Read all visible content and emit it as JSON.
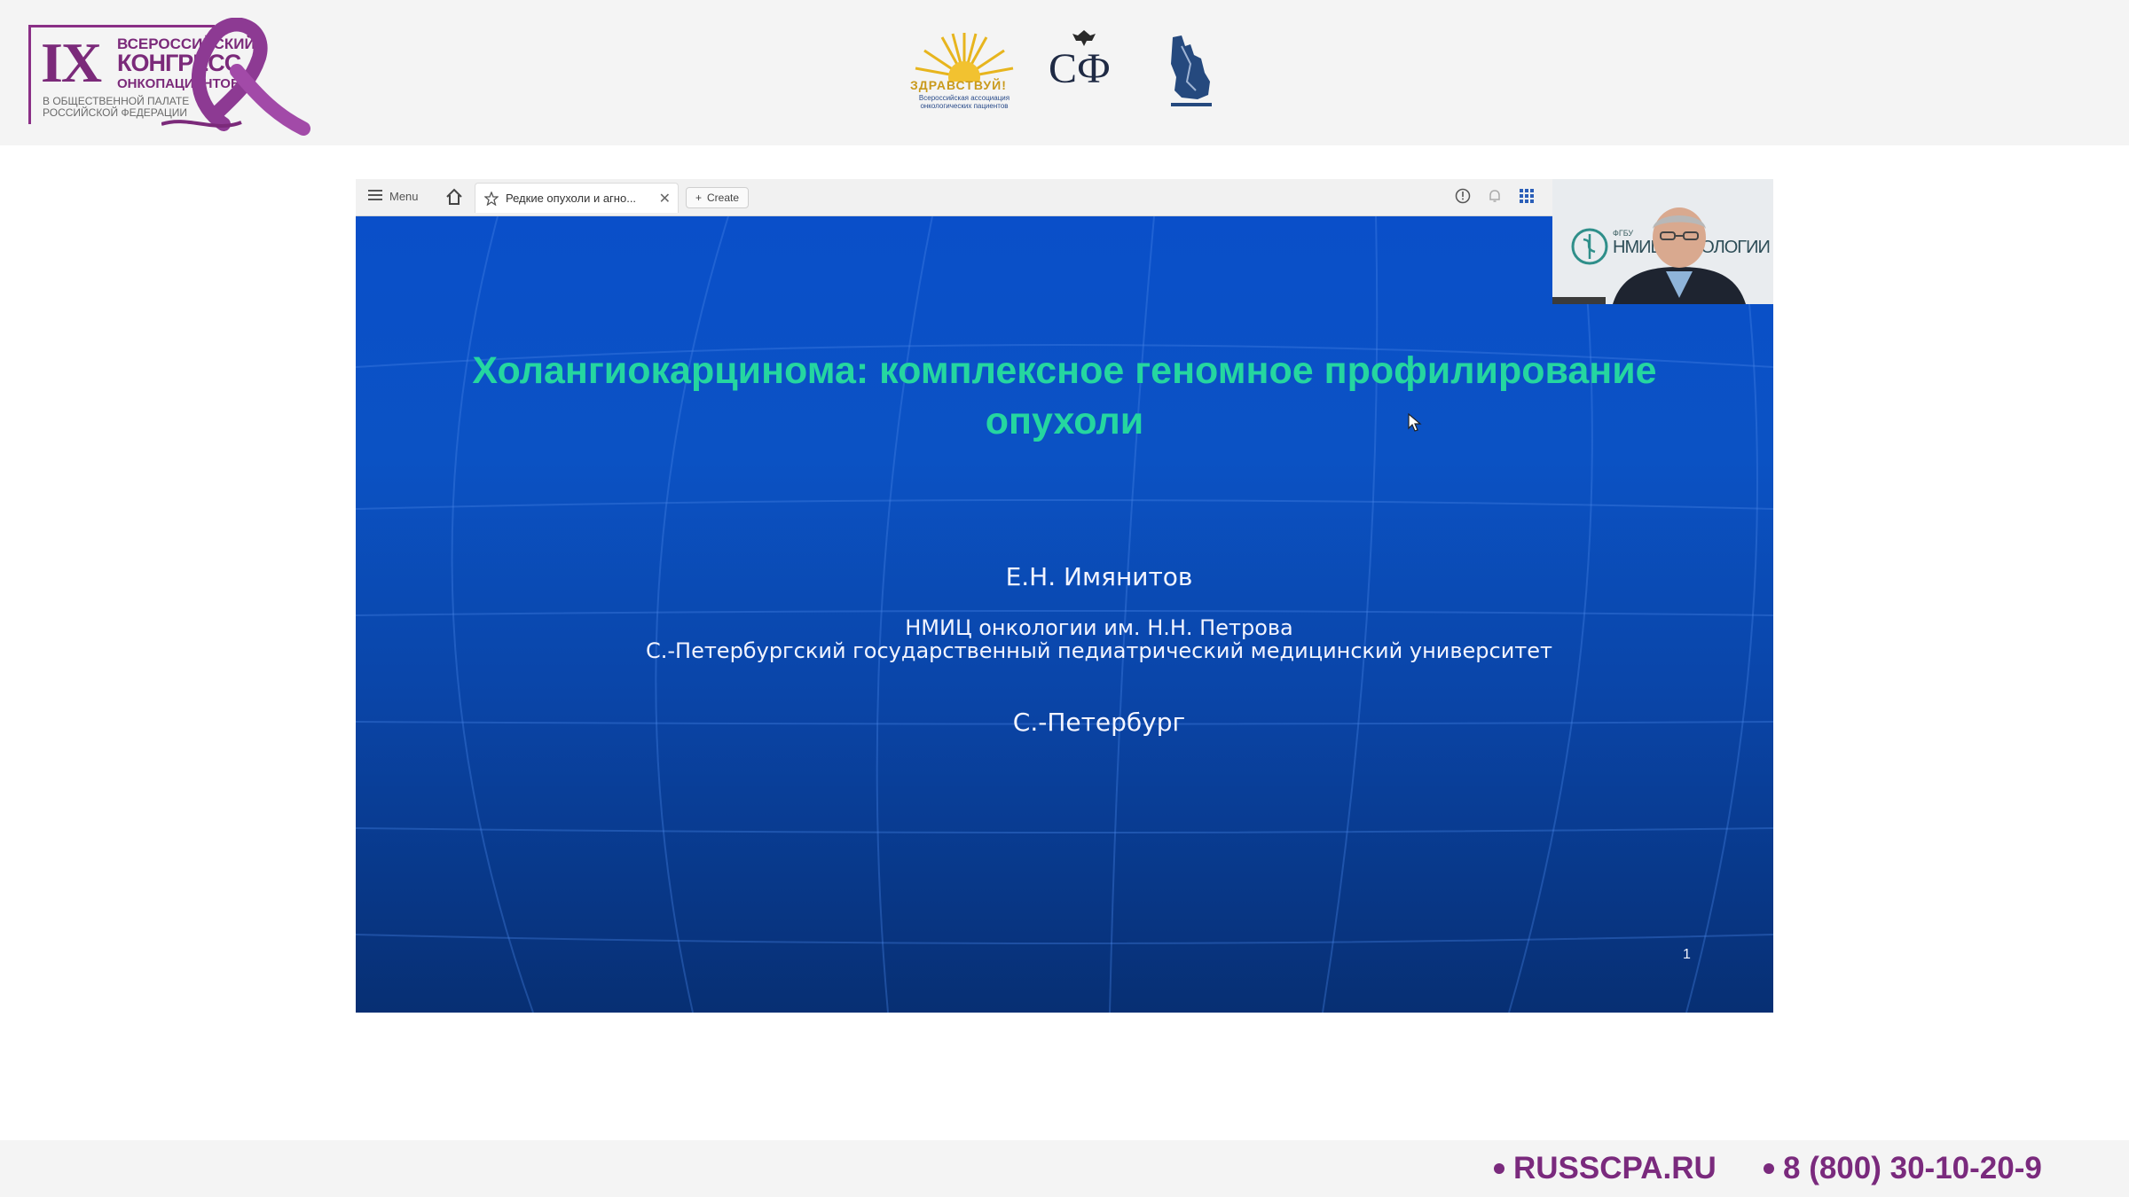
{
  "header": {
    "congress_logo": {
      "roman": "IX",
      "line1": "ВСЕРОССИЙСКИЙ",
      "line2": "КОНГРЕСС",
      "line3": "ОНКОПАЦИЕНТОВ",
      "line4": "В ОБЩЕСТВЕННОЙ ПАЛАТЕ РОССИЙСКОЙ ФЕДЕРАЦИИ"
    },
    "partners": {
      "zdravstvui": "ЗДРАВСТВУЙ!",
      "zdravstvui_sub": "Всероссийская ассоциация онкологических пациентов",
      "sf": "СФ"
    }
  },
  "browser": {
    "menu_label": "Menu",
    "tab_title": "Редкие опухоли и агно...",
    "create_label": "Create"
  },
  "slide": {
    "title": "Холангиокарцинома: комплексное геномное профилирование опухоли",
    "author": "Е.Н. Имянитов",
    "affiliation1": "НМИЦ онкологии им. Н.Н. Петрова",
    "affiliation2": "С.-Петербургский государственный педиатрический медицинский университет",
    "city": "С.-Петербург",
    "page_number": "1"
  },
  "webcam": {
    "org_small": "ФГБУ",
    "org_big": "НМИЦ ОНКОЛОГИИ"
  },
  "footer": {
    "site": "RUSSCPA.RU",
    "phone": "8 (800) 30-10-20-9"
  },
  "colors": {
    "brand_purple": "#7a2a7d",
    "slide_title": "#25d6a0",
    "slide_blue": "#0a4fc9"
  }
}
